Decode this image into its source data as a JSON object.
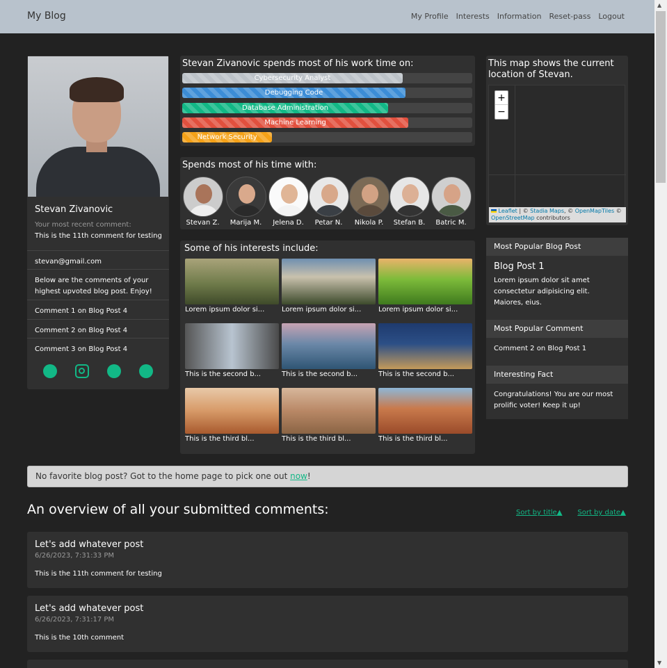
{
  "navbar": {
    "brand": "My Blog",
    "links": [
      "My Profile",
      "Interests",
      "Information",
      "Reset-pass",
      "Logout"
    ]
  },
  "profile": {
    "name": "Stevan Zivanovic",
    "recent_label": "Your most recent comment:",
    "recent_comment": "This is the 11th comment for testing",
    "email": "stevan@gmail.com",
    "comments_intro": "Below are the comments of your highest upvoted blog post. Enjoy!",
    "comments": [
      "Comment 1 on Blog Post 4",
      "Comment 2 on Blog Post 4",
      "Comment 3 on Blog Post 4"
    ],
    "socials": [
      "facebook-icon",
      "instagram-icon",
      "twitter-icon",
      "github-icon"
    ],
    "accent": "#12b886"
  },
  "work": {
    "title": "Stevan Zivanovic spends most of his work time on:",
    "skills": [
      {
        "label": "Cybersecurity Analyst",
        "percent": 76,
        "color": "#bcc2c8"
      },
      {
        "label": "Debugging Code",
        "percent": 77,
        "color": "#3c8dd6"
      },
      {
        "label": "Database Administration",
        "percent": 71,
        "color": "#12b886"
      },
      {
        "label": "Machine Learning",
        "percent": 78,
        "color": "#e2503e"
      },
      {
        "label": "Network Security",
        "percent": 31,
        "color": "#f4a118"
      }
    ]
  },
  "friends": {
    "title": "Spends most of his time with:",
    "people": [
      "Stevan Z.",
      "Marija M.",
      "Jelena D.",
      "Petar N.",
      "Nikola P.",
      "Stefan B.",
      "Batric M."
    ]
  },
  "interests": {
    "title": "Some of his interests include:",
    "items": [
      "Lorem ipsum dolor si...",
      "Lorem ipsum dolor si...",
      "Lorem ipsum dolor si...",
      "This is the second b...",
      "This is the second b...",
      "This is the second b...",
      "This is the third bl...",
      "This is the third bl...",
      "This is the third bl..."
    ]
  },
  "map": {
    "title": "This map shows the current location of Stevan.",
    "zoom_in": "+",
    "zoom_out": "−",
    "attribution": {
      "leaflet": "Leaflet",
      "sep1": " | © ",
      "stadia": "Stadia Maps",
      "sep2": ", © ",
      "openmaptiles": "OpenMapTiles",
      "sep3": " © ",
      "osm": "OpenStreetMap",
      "tail": " contributors"
    }
  },
  "sidebar": {
    "popular_post_header": "Most Popular Blog Post",
    "popular_post_title": "Blog Post 1",
    "popular_post_text": "Lorem ipsum dolor sit amet consectetur adipisicing elit. Maiores, eius.",
    "popular_comment_header": "Most Popular Comment",
    "popular_comment_text": "Comment 2 on Blog Post 1",
    "fact_header": "Interesting Fact",
    "fact_text": "Congratulations! You are our most prolific voter! Keep it up!"
  },
  "alert": {
    "text_before": "No favorite blog post? Got to the home page to pick one out ",
    "link": "now",
    "text_after": "!"
  },
  "overview": {
    "title": "An overview of all your submitted comments:",
    "sort_title": "Sort by title▲",
    "sort_date": "Sort by date▲",
    "comments": [
      {
        "title": "Let's add whatever post",
        "date": "6/26/2023, 7:31:33 PM",
        "text": "This is the 11th comment for testing"
      },
      {
        "title": "Let's add whatever post",
        "date": "6/26/2023, 7:31:17 PM",
        "text": "This is the 10th comment"
      }
    ]
  }
}
